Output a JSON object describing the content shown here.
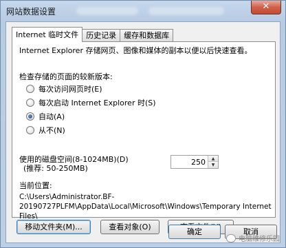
{
  "window": {
    "title": "网站数据设置",
    "close_glyph": "✕"
  },
  "tabs": [
    {
      "label": "Internet 临时文件",
      "active": true
    },
    {
      "label": "历史记录",
      "active": false
    },
    {
      "label": "缓存和数据库",
      "active": false
    }
  ],
  "temp_files": {
    "description": "Internet Explorer 存储网页、图像和媒体的副本以便以后快速查看。",
    "check_label": "检查存储的页面的较新版本:",
    "options": [
      {
        "label": "每次访问网页时(E)",
        "checked": false
      },
      {
        "label": "每次启动 Internet Explorer 时(S)",
        "checked": false
      },
      {
        "label": "自动(A)",
        "checked": true
      },
      {
        "label": "从不(N)",
        "checked": false
      }
    ],
    "disk_label": "使用的磁盘空间(8-1024MB)(D)",
    "disk_hint": "(推荐: 50-250MB)",
    "disk_value": "250",
    "location_label": "当前位置:",
    "location_path": "C:\\Users\\Administrator.BF-20190727PLFM\\AppData\\Local\\Microsoft\\Windows\\Temporary Internet Files\\",
    "buttons": {
      "move": "移动文件夹(M)...",
      "view_objects": "查看对象(O)",
      "view_files": "查看文件(V)"
    }
  },
  "footer": {
    "ok": "确定",
    "cancel": "取消"
  },
  "watermark": "电脑维修乐园"
}
